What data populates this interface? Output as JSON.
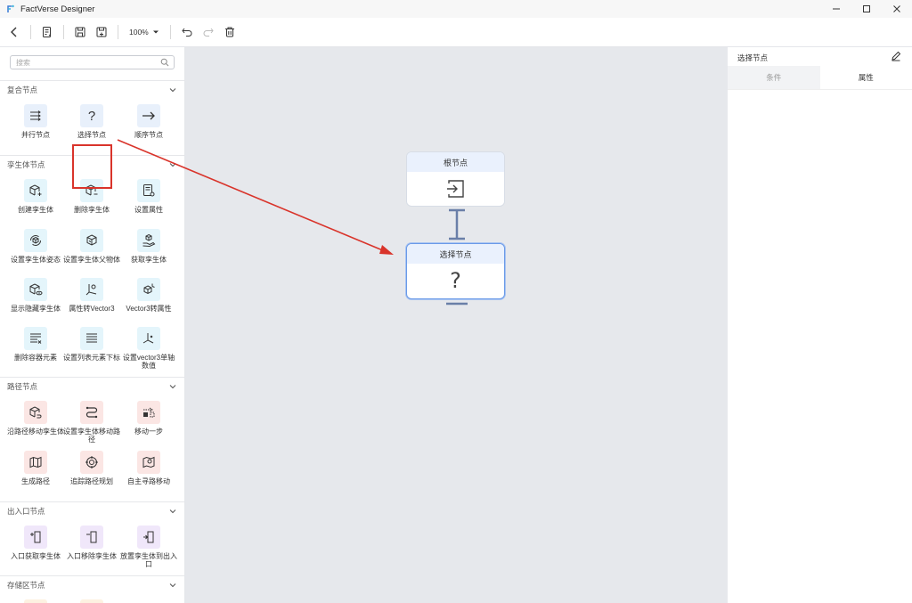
{
  "app": {
    "title": "FactVerse Designer"
  },
  "toolbar": {
    "zoom": "100%"
  },
  "search": {
    "placeholder": "搜索"
  },
  "sections": [
    {
      "title": "复合节点",
      "items": [
        {
          "label": "并行节点",
          "icon": "parallel-icon"
        },
        {
          "label": "选择节点",
          "icon": "question-icon"
        },
        {
          "label": "顺序节点",
          "icon": "arrow-right-icon"
        }
      ]
    },
    {
      "title": "孪生体节点",
      "items": [
        {
          "label": "创建孪生体",
          "icon": "cube-plus-icon"
        },
        {
          "label": "删除孪生体",
          "icon": "cube-minus-icon"
        },
        {
          "label": "设置属性",
          "icon": "doc-gear-icon"
        },
        {
          "label": "设置孪生体姿态",
          "icon": "cube-rotate-icon"
        },
        {
          "label": "设置孪生体父物体",
          "icon": "cube-parent-icon"
        },
        {
          "label": "获取孪生体",
          "icon": "hand-cube-icon"
        },
        {
          "label": "显示隐藏孪生体",
          "icon": "cube-eye-icon"
        },
        {
          "label": "属性转Vector3",
          "icon": "axis-gear-icon"
        },
        {
          "label": "Vector3转属性",
          "icon": "cube-axis-icon"
        },
        {
          "label": "删除容器元素",
          "icon": "list-remove-icon"
        },
        {
          "label": "设置列表元素下标",
          "icon": "list-set-icon"
        },
        {
          "label": "设置vector3单轴数值",
          "icon": "axis-icon"
        }
      ]
    },
    {
      "title": "路径节点",
      "items": [
        {
          "label": "沿路径移动孪生体",
          "icon": "cube-path-icon"
        },
        {
          "label": "设置孪生体移动路径",
          "icon": "route-icon"
        },
        {
          "label": "移动一步",
          "icon": "step-icon"
        },
        {
          "label": "生成路径",
          "icon": "map-icon"
        },
        {
          "label": "追踪路径规划",
          "icon": "target-icon"
        },
        {
          "label": "自主寻路移动",
          "icon": "map-pin-icon"
        }
      ]
    },
    {
      "title": "出入口节点",
      "items": [
        {
          "label": "入口获取孪生体",
          "icon": "door-in-icon"
        },
        {
          "label": "入口移除孪生体",
          "icon": "door-out-icon"
        },
        {
          "label": "放置孪生体到出入口",
          "icon": "door-place-icon"
        }
      ]
    },
    {
      "title": "存储区节点",
      "items": []
    }
  ],
  "canvas": {
    "root_node": {
      "title": "根节点",
      "icon": "enter-icon"
    },
    "selector_node": {
      "title": "选择节点",
      "icon": "question-icon"
    }
  },
  "right_panel": {
    "title": "选择节点",
    "tabs": [
      {
        "label": "条件"
      },
      {
        "label": "属性"
      }
    ],
    "active_tab": "属性"
  },
  "colors": {
    "highlight": "#d9342b",
    "arrow": "#d9342b",
    "node_border_selected": "#6a9ae8",
    "connector": "#6a7fa8"
  }
}
